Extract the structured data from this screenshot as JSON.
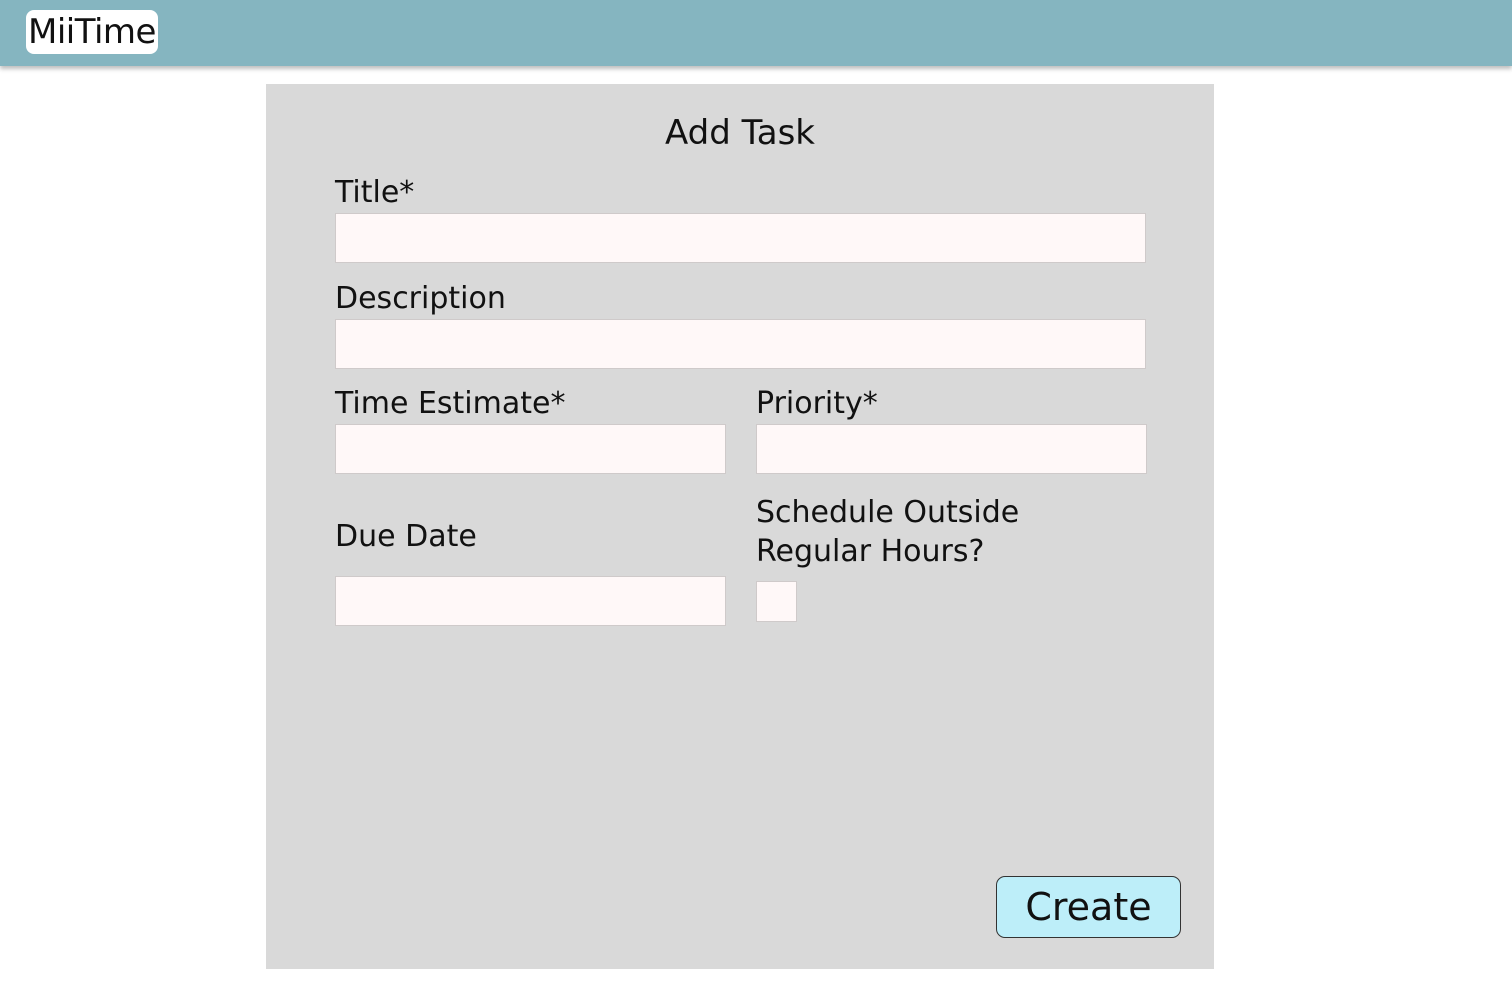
{
  "app": {
    "name": "MiiTime"
  },
  "form": {
    "title": "Add Task",
    "fields": {
      "title": {
        "label": "Title*",
        "value": ""
      },
      "description": {
        "label": "Description",
        "value": ""
      },
      "time_estimate": {
        "label": "Time Estimate*",
        "value": ""
      },
      "priority": {
        "label": "Priority*",
        "value": ""
      },
      "due_date": {
        "label": "Due Date",
        "value": ""
      },
      "schedule_outside": {
        "label": "Schedule Outside Regular Hours?",
        "checked": false
      }
    },
    "submit_label": "Create"
  },
  "colors": {
    "header": "#85b5c0",
    "panel": "#d9d9d9",
    "input_bg": "#fff8f8",
    "button_bg": "#bdeef9"
  }
}
